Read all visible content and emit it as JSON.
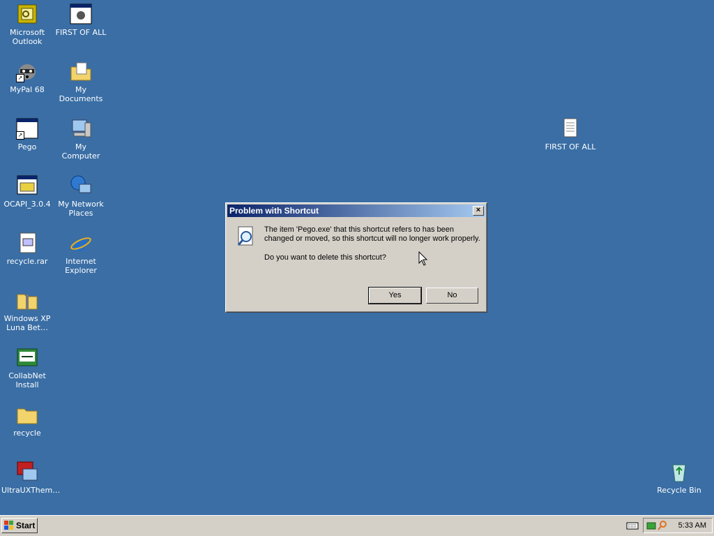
{
  "desktop": {
    "background": "#3a6ea5",
    "icons": [
      {
        "label": "Microsoft Outlook",
        "icon": "outlook-icon"
      },
      {
        "label": "FIRST OF ALL",
        "icon": "program-window-icon"
      },
      {
        "label": "MyPal 68",
        "icon": "mypal-raccoon-icon"
      },
      {
        "label": "My Documents",
        "icon": "my-documents-icon"
      },
      {
        "label": "Pego",
        "icon": "program-window-icon"
      },
      {
        "label": "My Computer",
        "icon": "my-computer-icon"
      },
      {
        "label": "OCAPI_3.0.4",
        "icon": "installer-icon"
      },
      {
        "label": "My Network Places",
        "icon": "network-places-icon"
      },
      {
        "label": "recycle.rar",
        "icon": "archive-icon"
      },
      {
        "label": "Internet Explorer",
        "icon": "internet-explorer-icon"
      },
      {
        "label": "Windows XP Luna Bet…",
        "icon": "zip-folder-icon"
      },
      {
        "label": "CollabNet Install",
        "icon": "installer-icon"
      },
      {
        "label": "recycle",
        "icon": "folder-icon"
      },
      {
        "label": "UltraUXThem…",
        "icon": "theme-icon"
      },
      {
        "label": "FIRST OF ALL",
        "icon": "text-document-icon"
      },
      {
        "label": "Recycle Bin",
        "icon": "recycle-bin-icon"
      }
    ]
  },
  "dialog": {
    "title": "Problem with Shortcut",
    "close_label": "×",
    "message": "The item 'Pego.exe' that this shortcut refers to has been changed or moved, so this shortcut will no longer work properly.",
    "question": "Do you want to delete this shortcut?",
    "yes_label": "Yes",
    "no_label": "No",
    "icon": "search-document-icon"
  },
  "taskbar": {
    "start_label": "Start",
    "clock": "5:33 AM",
    "tray_icons": [
      "keyboard-icon",
      "network-tray-icon",
      "search-tray-icon"
    ]
  }
}
